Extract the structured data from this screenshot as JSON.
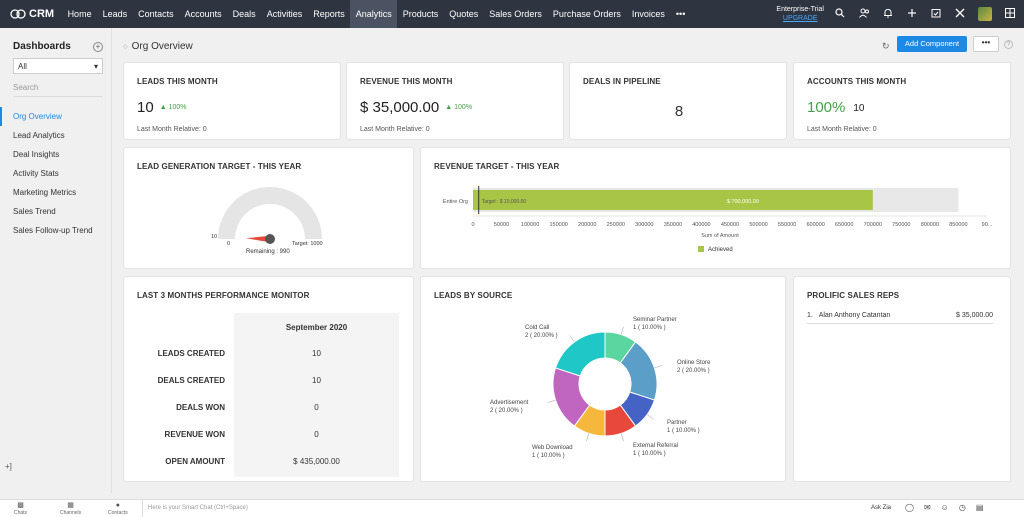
{
  "app": {
    "name": "CRM"
  },
  "nav": [
    "Home",
    "Leads",
    "Contacts",
    "Accounts",
    "Deals",
    "Activities",
    "Reports",
    "Analytics",
    "Products",
    "Quotes",
    "Sales Orders",
    "Purchase Orders",
    "Invoices",
    "•••"
  ],
  "nav_active": "Analytics",
  "trial": {
    "label": "Enterprise-Trial",
    "upgrade": "UPGRADE"
  },
  "sidebar": {
    "title": "Dashboards",
    "add": "+",
    "select_value": "All",
    "search_placeholder": "Search",
    "items": [
      "Org Overview",
      "Lead Analytics",
      "Deal Insights",
      "Activity Stats",
      "Marketing Metrics",
      "Sales Trend",
      "Sales Follow-up Trend"
    ],
    "active_item": "Org Overview",
    "bottom": "+]"
  },
  "header": {
    "title": "Org Overview",
    "add_component": "Add Component",
    "more": "•••",
    "help": "?"
  },
  "kpis": [
    {
      "title": "LEADS THIS MONTH",
      "value": "10",
      "pct": "100%",
      "sub": "Last Month Relative: 0"
    },
    {
      "title": "REVENUE THIS MONTH",
      "value": "$ 35,000.00",
      "pct": "100%",
      "sub": "Last Month Relative: 0"
    },
    {
      "title": "DEALS IN PIPELINE",
      "value": "8"
    },
    {
      "title": "ACCOUNTS THIS MONTH",
      "value": "100%",
      "secondary": "10",
      "sub": "Last Month Relative: 0"
    }
  ],
  "lead_target": {
    "title": "LEAD GENERATION TARGET - THIS YEAR",
    "min": "0",
    "actual": "10",
    "target": "Target: 1000",
    "remaining": "Remaining : 990",
    "value_fraction": 0.01
  },
  "revenue_target": {
    "title": "REVENUE TARGET - THIS YEAR"
  },
  "chart_data": [
    {
      "type": "bar",
      "title": "REVENUE TARGET - THIS YEAR",
      "categories": [
        "Entire Org"
      ],
      "series": [
        {
          "name": "Achieved",
          "values": [
            700000
          ]
        }
      ],
      "target": 10000,
      "target_label": "Target : $ 10,000.00",
      "bar_label": "$ 700,000.00",
      "background_max": 850000,
      "xlabel": "Sum of Amount",
      "xlim": [
        0,
        900000
      ],
      "xticks": [
        "0",
        "50000",
        "100000",
        "150000",
        "200000",
        "250000",
        "300000",
        "350000",
        "400000",
        "450000",
        "500000",
        "550000",
        "600000",
        "650000",
        "700000",
        "750000",
        "800000",
        "850000",
        "90..."
      ],
      "legend": "bottom",
      "colors": {
        "achieved": "#a8c545",
        "bg": "#e8e8e8"
      }
    },
    {
      "type": "pie",
      "title": "LEADS BY SOURCE",
      "donut": true,
      "slices": [
        {
          "name": "Seminar Partner",
          "value": 1,
          "label": "1 ( 10.00% )",
          "color": "#5cd6a0"
        },
        {
          "name": "Online Store",
          "value": 2,
          "label": "2 ( 20.00% )",
          "color": "#5b9fc9"
        },
        {
          "name": "Partner",
          "value": 1,
          "label": "1 ( 10.00% )",
          "color": "#4563c4"
        },
        {
          "name": "External Referral",
          "value": 1,
          "label": "1 ( 10.00% )",
          "color": "#e8473b"
        },
        {
          "name": "Web Download",
          "value": 1,
          "label": "1 ( 10.00% )",
          "color": "#f5b83d"
        },
        {
          "name": "Advertisement",
          "value": 2,
          "label": "2 ( 20.00% )",
          "color": "#c066c0"
        },
        {
          "name": "Cold Call",
          "value": 2,
          "label": "2 ( 20.00% )",
          "color": "#1fc7c7"
        }
      ]
    }
  ],
  "perf": {
    "title": "LAST 3 MONTHS PERFORMANCE MONITOR",
    "month": "September 2020",
    "rows": [
      {
        "label": "LEADS CREATED",
        "value": "10"
      },
      {
        "label": "DEALS CREATED",
        "value": "10"
      },
      {
        "label": "DEALS WON",
        "value": "0"
      },
      {
        "label": "REVENUE WON",
        "value": "0"
      },
      {
        "label": "OPEN AMOUNT",
        "value": "$ 435,000.00"
      }
    ]
  },
  "leads_source": {
    "title": "LEADS BY SOURCE"
  },
  "reps": {
    "title": "PROLIFIC SALES REPS",
    "items": [
      {
        "rank": "1.",
        "name": "Alan Anthony Catantan",
        "amount": "$ 35,000.00"
      }
    ]
  },
  "bottom": {
    "chats": "Chats",
    "channels": "Channels",
    "contacts": "Contacts",
    "smart_chat": "Here is your Smart Chat (Ctrl+Space)",
    "ask_zia": "Ask Zia"
  }
}
